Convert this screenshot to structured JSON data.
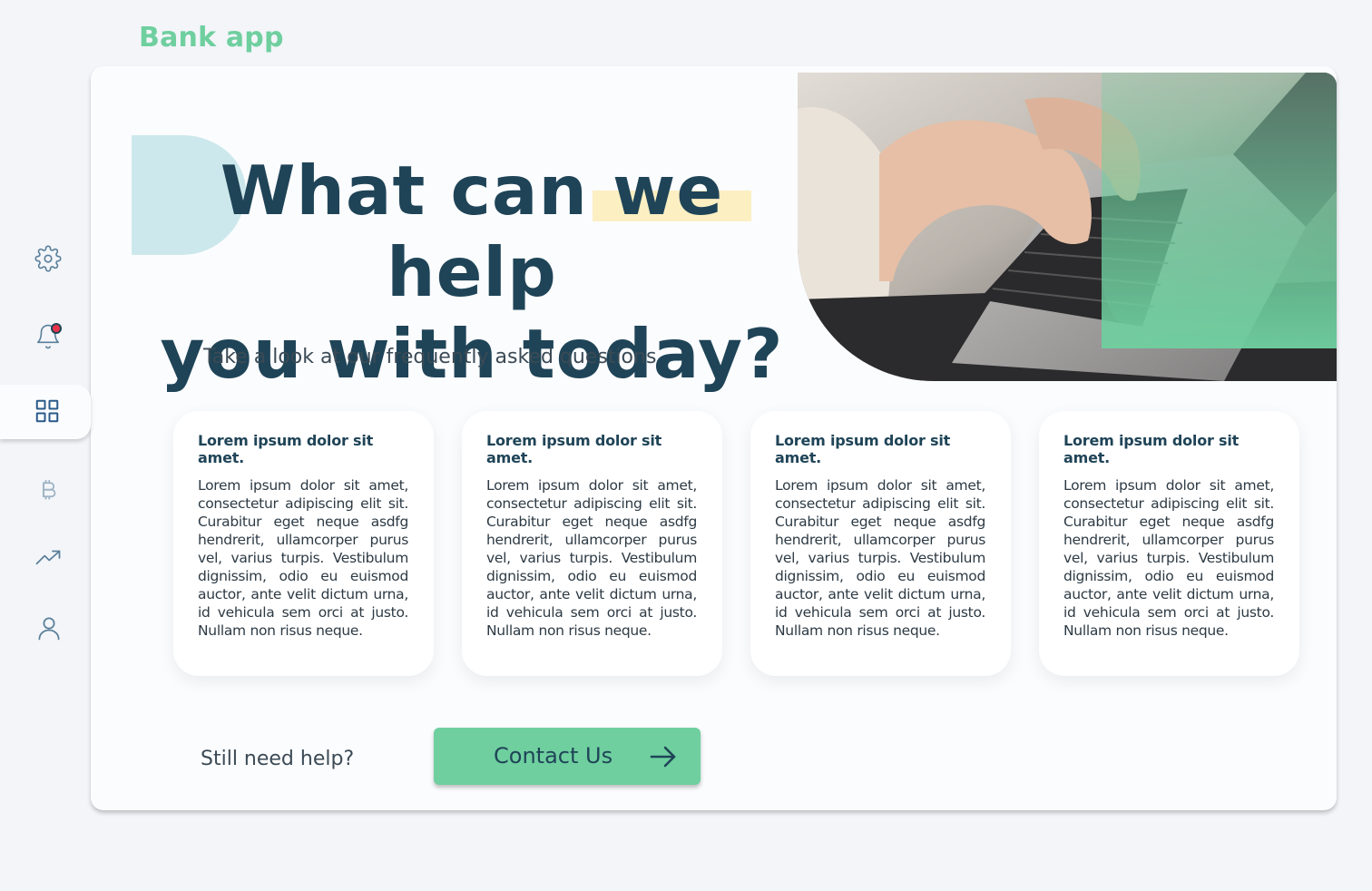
{
  "app": {
    "title": "Bank app"
  },
  "sidebar": {
    "items": [
      {
        "name": "settings",
        "icon": "gear-icon"
      },
      {
        "name": "notifications",
        "icon": "bell-icon",
        "has_badge": true
      },
      {
        "name": "dashboard",
        "icon": "grid-icon",
        "active": true
      },
      {
        "name": "crypto",
        "icon": "bitcoin-icon"
      },
      {
        "name": "trends",
        "icon": "trending-up-icon"
      },
      {
        "name": "profile",
        "icon": "user-icon"
      }
    ]
  },
  "hero": {
    "title_line1_part1": "What can we ",
    "title_line1_highlight": "help",
    "title_line2": "you with today?",
    "subtitle": "Take a look at our frequently asked questions"
  },
  "faq": [
    {
      "title": "Lorem ipsum dolor sit amet.",
      "body": "Lorem ipsum dolor sit amet, consectetur adipiscing elit sit. Curabitur eget neque asdfg hendrerit, ullamcorper purus vel, varius turpis. Vestibulum dignissim, odio eu euismod auctor, ante velit dictum urna, id vehicula sem orci at justo. Nullam non risus neque."
    },
    {
      "title": "Lorem ipsum dolor sit amet.",
      "body": "Lorem ipsum dolor sit amet, consectetur adipiscing elit sit. Curabitur eget neque asdfg hendrerit, ullamcorper purus vel, varius turpis. Vestibulum dignissim, odio eu euismod auctor, ante velit dictum urna, id vehicula sem orci at justo. Nullam non risus neque."
    },
    {
      "title": "Lorem ipsum dolor sit amet.",
      "body": "Lorem ipsum dolor sit amet, consectetur adipiscing elit sit. Curabitur eget neque asdfg hendrerit, ullamcorper purus vel, varius turpis. Vestibulum dignissim, odio eu euismod auctor, ante velit dictum urna, id vehicula sem orci at justo. Nullam non risus neque."
    },
    {
      "title": "Lorem ipsum dolor sit amet.",
      "body": "Lorem ipsum dolor sit amet, consectetur adipiscing elit sit. Curabitur eget neque asdfg hendrerit, ullamcorper purus vel, varius turpis. Vestibulum dignissim, odio eu euismod auctor, ante velit dictum urna, id vehicula sem orci at justo. Nullam non risus neque."
    }
  ],
  "footer": {
    "help_text": "Still need help?",
    "contact_label": "Contact Us"
  },
  "colors": {
    "brand_green": "#6fcf9f",
    "navy": "#1f4457",
    "highlight_yellow": "#fcefc2",
    "blob_blue": "#cde8ec",
    "badge_red": "#e8334a"
  }
}
